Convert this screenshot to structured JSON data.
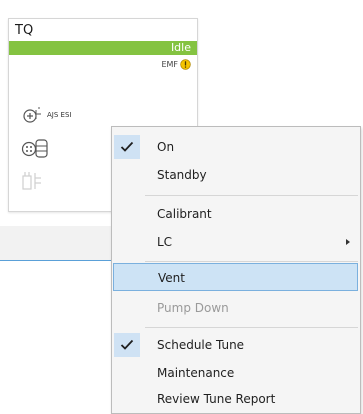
{
  "card": {
    "title": "TQ",
    "status": "Idle",
    "status_color": "#84c341",
    "emf_label": "EMF",
    "warning_color": "#f5c400",
    "modules": [
      {
        "icon": "ion-source-icon",
        "label": "AJS ESI"
      },
      {
        "icon": "pump-tank-icon",
        "label": ""
      },
      {
        "icon": "lc-module-icon",
        "label": ""
      }
    ]
  },
  "menu": {
    "items": [
      {
        "label": "On",
        "checked": true
      },
      {
        "label": "Standby"
      },
      {
        "label": "Calibrant"
      },
      {
        "label": "LC",
        "submenu": true
      },
      {
        "label": "Vent",
        "highlighted": true
      },
      {
        "label": "Pump Down",
        "disabled": true
      },
      {
        "label": "Schedule Tune",
        "checked": true
      },
      {
        "label": "Maintenance"
      },
      {
        "label": "Review Tune Report"
      }
    ]
  }
}
